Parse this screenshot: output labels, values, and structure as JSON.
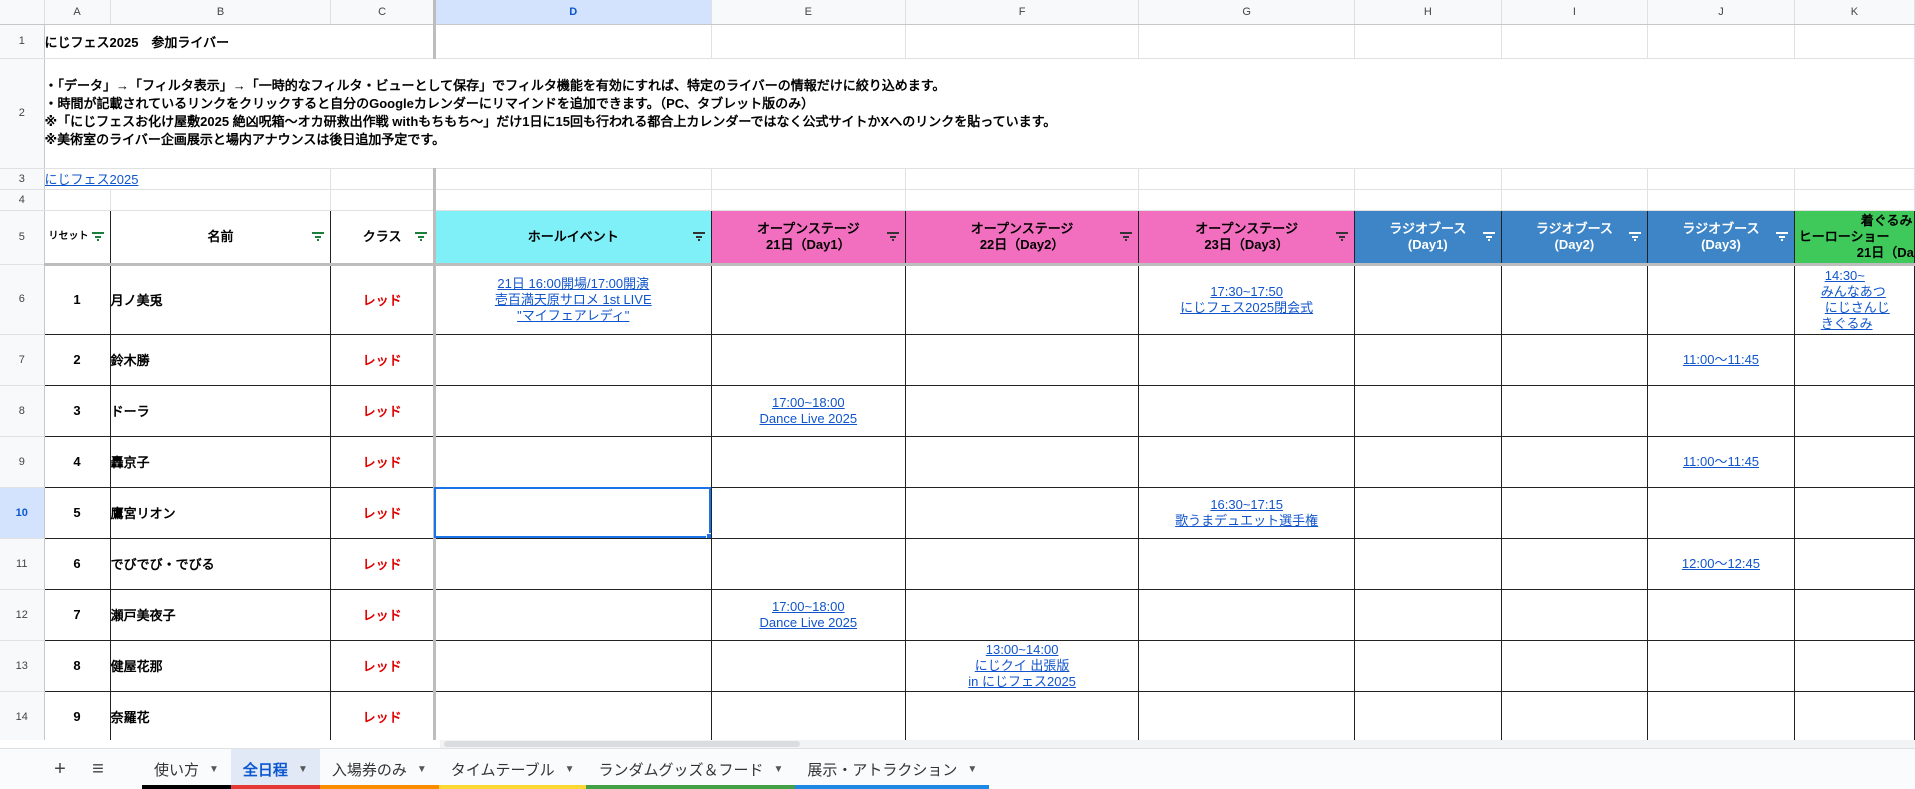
{
  "columns": [
    "A",
    "B",
    "C",
    "D",
    "E",
    "F",
    "G",
    "H",
    "I",
    "J",
    "K"
  ],
  "rows": {
    "r1": "1",
    "r2": "2",
    "r3": "3",
    "r4": "4",
    "r5": "5"
  },
  "title": "にじフェス2025　参加ライバー",
  "notes": [
    "・「データ」→「フィルタ表示」→「一時的なフィルタ・ビューとして保存」でフィルタ機能を有効にすれば、特定のライバーの情報だけに絞り込めます。",
    "・時間が記載されているリンクをクリックすると自分のGoogleカレンダーにリマインドを追加できます。（PC、タブレット版のみ）",
    "※「にじフェスお化け屋敷2025 絶凶呪箱〜オカ研救出作戦 withもちもち〜」だけ1日に15回も行われる都合上カレンダーではなく公式サイトかXへのリンクを貼っています。",
    "※美術室のライバー企画展示と場内アナウンスは後日追加予定です。"
  ],
  "top_link": "にじフェス2025",
  "headers": {
    "reset": "リセット",
    "name": "名前",
    "cls": "クラス",
    "hall": "ホールイベント",
    "open1": [
      "オープンステージ",
      "21日（Day1）"
    ],
    "open2": [
      "オープンステージ",
      "22日（Day2）"
    ],
    "open3": [
      "オープンステージ",
      "23日（Day3）"
    ],
    "radio1": [
      "ラジオブース",
      "(Day1)"
    ],
    "radio2": [
      "ラジオブース",
      "(Day2)"
    ],
    "radio3": [
      "ラジオブース",
      "(Day3)"
    ],
    "kigurumi": [
      "着ぐるみ",
      "ヒーローショー",
      "21日（Da"
    ]
  },
  "colors": {
    "hall": "#7ff0f8",
    "open": "#f26fbf",
    "radio": "#3d85c6",
    "kigurumi": "#3ec95a",
    "red": "#e00000",
    "link": "#1155cc",
    "select": "#1a73e8"
  },
  "data_rows": [
    {
      "rownum": "6",
      "num": "1",
      "name": "月ノ美兎",
      "cls": "レッド",
      "hall": [
        "21日 16:00開場/17:00開演",
        "壱百満天原サロメ 1st LIVE",
        "\"マイフェアレディ\""
      ],
      "open3": [
        "17:30~17:50",
        "にじフェス2025閉会式"
      ],
      "kig": [
        "14:30~",
        "みんなあつ",
        "にじさんじ",
        "きぐるみ"
      ]
    },
    {
      "rownum": "7",
      "num": "2",
      "name": "鈴木勝",
      "cls": "レッド",
      "radio3": [
        "11:00～11:45"
      ]
    },
    {
      "rownum": "8",
      "num": "3",
      "name": "ドーラ",
      "cls": "レッド",
      "open1": [
        "17:00~18:00",
        "Dance Live 2025"
      ]
    },
    {
      "rownum": "9",
      "num": "4",
      "name": "轟京子",
      "cls": "レッド",
      "radio3": [
        "11:00～11:45"
      ]
    },
    {
      "rownum": "10",
      "num": "5",
      "name": "鷹宮リオン",
      "cls": "レッド",
      "open3": [
        "16:30~17:15",
        "歌うまデュエット選手権"
      ]
    },
    {
      "rownum": "11",
      "num": "6",
      "name": "でびでび・でびる",
      "cls": "レッド",
      "radio3": [
        "12:00～12:45"
      ]
    },
    {
      "rownum": "12",
      "num": "7",
      "name": "瀬戸美夜子",
      "cls": "レッド",
      "open1": [
        "17:00~18:00",
        "Dance Live 2025"
      ]
    },
    {
      "rownum": "13",
      "num": "8",
      "name": "健屋花那",
      "cls": "レッド",
      "open2": [
        "13:00~14:00",
        "にじクイ 出張版",
        "in にじフェス2025"
      ]
    },
    {
      "rownum": "14",
      "num": "9",
      "name": "奈羅花",
      "cls": "レッド"
    }
  ],
  "tabs": [
    {
      "label": "使い方",
      "color": "#000000"
    },
    {
      "label": "全日程",
      "color": "#e53935"
    },
    {
      "label": "入場券のみ",
      "color": "#fb8c00"
    },
    {
      "label": "タイムテーブル",
      "color": "#fdd835"
    },
    {
      "label": "ランダムグッズ＆フード",
      "color": "#43a047"
    },
    {
      "label": "展示・アトラクション",
      "color": "#1e88e5"
    }
  ],
  "active_tab": "全日程",
  "icons": {
    "add": "plus-icon",
    "menu": "hamburger-menu-icon",
    "filter": "filter-icon",
    "caret": "caret-down-icon"
  }
}
